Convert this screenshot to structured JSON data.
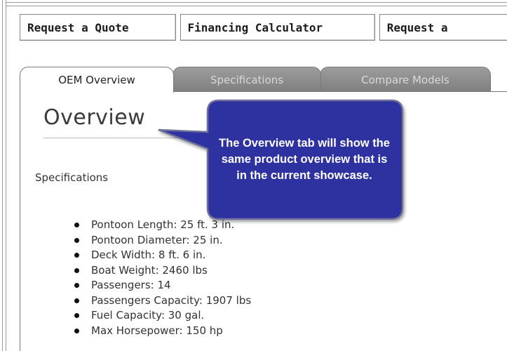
{
  "action_buttons": [
    {
      "label": "Request a Quote"
    },
    {
      "label": "Financing Calculator"
    },
    {
      "label": "Request a"
    }
  ],
  "tabs": [
    {
      "label": "OEM Overview",
      "active": true
    },
    {
      "label": "Specifications",
      "active": false
    },
    {
      "label": "Compare Models",
      "active": false
    }
  ],
  "overview": {
    "title": "Overview",
    "spec_heading": "Specifications",
    "specs": [
      "Pontoon Length: 25 ft. 3 in.",
      "Pontoon Diameter: 25 in.",
      "Deck Width: 8 ft. 6 in.",
      "Boat Weight: 2460 lbs",
      "Passengers: 14",
      "Passengers Capacity: 1907 lbs",
      "Fuel Capacity: 30 gal.",
      "Max Horsepower: 150 hp"
    ]
  },
  "callout": {
    "text": "The Overview tab will show the same product overview that is in the current showcase."
  },
  "colors": {
    "callout_fill": "#2d33a0",
    "callout_border": "#6f6f9a",
    "tab_inactive": "#8c8c8c",
    "border": "#7a7a7a"
  }
}
